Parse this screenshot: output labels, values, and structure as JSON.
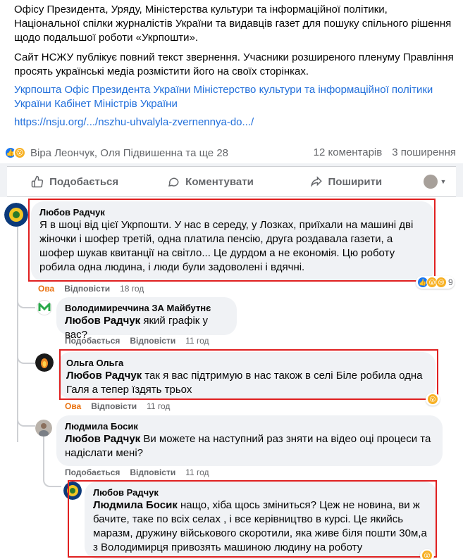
{
  "post": {
    "paragraph1": "Офісу Президента, Уряду, Міністерства культури та інформаційної політики, Національної спілки журналістів України та видавців газет для пошуку спільного рішення щодо подальшої роботи «Укрпошти».",
    "paragraph2": "Сайт НСЖУ публікує повний текст звернення. Учасники розширеного пленуму Правління просять українські медіа розмістити його на своїх сторінках.",
    "tags": "Укрпошта Офіс Президента України Міністерство культури та інформаційної політики України Кабінет Міністрів України",
    "link": "https://nsju.org/.../nszhu-uhvalyla-zvernennya-do.../"
  },
  "stats": {
    "reactors": "Віра Леончук, Оля Підвишенна та ще 28",
    "comments": "12 коментарів",
    "shares": "3 поширення"
  },
  "actions": {
    "like": "Подобається",
    "comment": "Коментувати",
    "share": "Поширити"
  },
  "comments": [
    {
      "author": "Любов Радчук",
      "text": "Я в шоці від цієї Укрпошти. У нас в середу, у Лозках, приїхали на машині дві жіночки і шофер третій, одна платила пенсію, друга роздавала газети, а шофер шукав квитанції на світло... Це дурдом а не економія. Цю роботу робила одна людина, і люди були задоволені і вдячні.",
      "reaction": "Ова",
      "reply": "Відповісти",
      "time": "18 год",
      "reaction_count": "9"
    },
    {
      "author": "Володимиреччина ЗА Майбутнє",
      "mention": "Любов Радчук",
      "text": " який графік у вас?",
      "like": "Подобається",
      "reply": "Відповісти",
      "time": "11 год"
    },
    {
      "author": "Ольга Ольга",
      "mention": "Любов Радчук",
      "text": " так я вас підтримую в нас також в селі Біле робила одна Галя а тепер їздять трьох",
      "reaction": "Ова",
      "reply": "Відповісти",
      "time": "11 год"
    },
    {
      "author": "Людмила Босик",
      "mention": "Любов Радчук",
      "text": " Ви можете на наступний раз зняти на відео оці процеси та надіслати мені?",
      "like": "Подобається",
      "reply": "Відповісти",
      "time": "11 год"
    },
    {
      "author": "Любов Радчук",
      "mention": "Людмила Босик",
      "text": " нащо, хіба щось зміниться? Цеж не новина, ви ж бачите, таке по всіх селах , і все керівництво в курсі. Це якийсь маразм, дружину військового скоротили, яка живе біля пошти 30м,а з Володимирця привозять машиною людину на роботу"
    }
  ],
  "colors": {
    "link": "#216fdb",
    "highlight_box": "#e02020",
    "wow_reaction": "#e9710f"
  }
}
